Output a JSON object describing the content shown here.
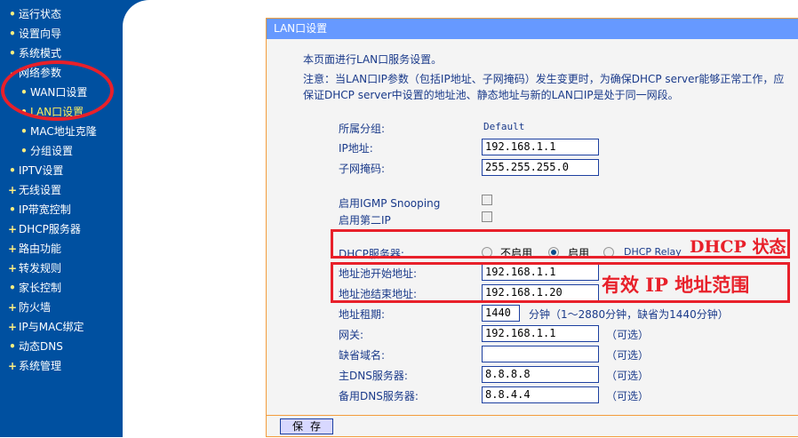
{
  "sidebar": {
    "items": [
      {
        "label": "运行状态",
        "bullet": "•"
      },
      {
        "label": "设置向导",
        "bullet": "•"
      },
      {
        "label": "系统模式",
        "bullet": "•"
      },
      {
        "label": "网络参数",
        "bullet": "-"
      },
      {
        "label": "WAN口设置",
        "bullet": "•",
        "sub": true
      },
      {
        "label": "LAN口设置",
        "bullet": "•",
        "sub": true,
        "active": true
      },
      {
        "label": "MAC地址克隆",
        "bullet": "•",
        "sub": true
      },
      {
        "label": "分组设置",
        "bullet": "•",
        "sub": true
      },
      {
        "label": "IPTV设置",
        "bullet": "•"
      },
      {
        "label": "无线设置",
        "bullet": "+"
      },
      {
        "label": "IP带宽控制",
        "bullet": "•"
      },
      {
        "label": "DHCP服务器",
        "bullet": "+"
      },
      {
        "label": "路由功能",
        "bullet": "+"
      },
      {
        "label": "转发规则",
        "bullet": "+"
      },
      {
        "label": "家长控制",
        "bullet": "•"
      },
      {
        "label": "防火墙",
        "bullet": "+"
      },
      {
        "label": "IP与MAC绑定",
        "bullet": "+"
      },
      {
        "label": "动态DNS",
        "bullet": "•"
      },
      {
        "label": "系统管理",
        "bullet": "+"
      }
    ]
  },
  "panel": {
    "title": "LAN口设置",
    "intro": "本页面进行LAN口服务设置。",
    "note1": "注意：当LAN口IP参数（包括IP地址、子网掩码）发生变更时，为确保DHCP server能够正常工作，应",
    "note2": "保证DHCP server中设置的地址池、静态地址与新的LAN口IP是处于同一网段。"
  },
  "form": {
    "group_label": "所属分组:",
    "group_value": "Default",
    "ip_label": "IP地址:",
    "ip_value": "192.168.1.1",
    "mask_label": "子网掩码:",
    "mask_value": "255.255.255.0",
    "igmp_label": "启用IGMP Snooping",
    "igmp_checked": false,
    "second_ip_label": "启用第二IP",
    "second_ip_checked": false,
    "dhcp_label": "DHCP服务器:",
    "dhcp_options": [
      "不启用",
      "启用",
      "DHCP Relay"
    ],
    "dhcp_selected": "启用",
    "start_label": "地址池开始地址:",
    "start_value": "192.168.1.1",
    "end_label": "地址池结束地址:",
    "end_value": "192.168.1.20",
    "lease_label": "地址租期:",
    "lease_value": "1440",
    "lease_hint": "分钟（1～2880分钟，缺省为1440分钟）",
    "gateway_label": "网关:",
    "gateway_value": "192.168.1.1",
    "domain_label": "缺省域名:",
    "domain_value": "",
    "dns1_label": "主DNS服务器:",
    "dns1_value": "8.8.8.8",
    "dns2_label": "备用DNS服务器:",
    "dns2_value": "8.8.4.4",
    "optional": "（可选）",
    "save": "保存"
  },
  "annotations": {
    "dhcp_state": "DHCP 状态",
    "ip_range": "有效 IP 地址范围",
    "color": "#e8202a"
  }
}
